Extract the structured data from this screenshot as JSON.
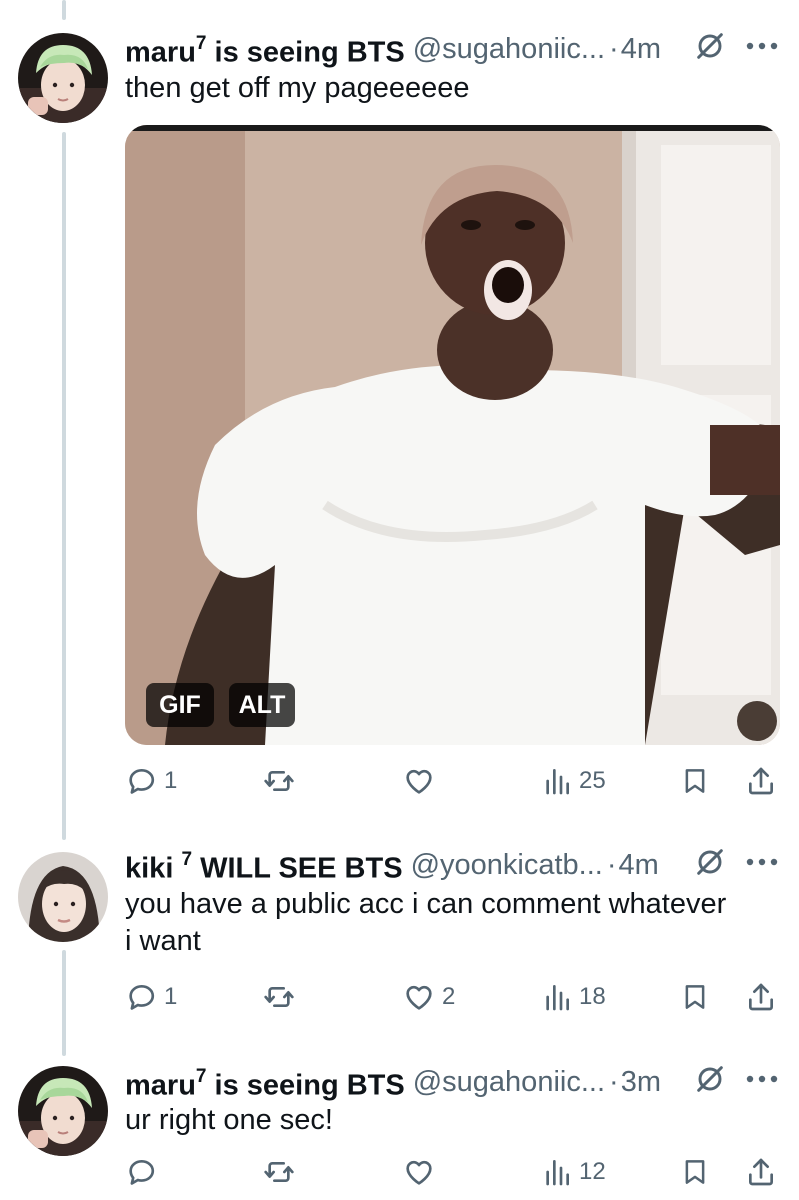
{
  "tweets": [
    {
      "name": "maru",
      "name_sup": "7",
      "name_rest": " is seeing BTS",
      "handle": "@sugahoniic...",
      "separator": "·",
      "time": "4m",
      "text": "then get off my pageeeeee",
      "media": {
        "gif_badge": "GIF",
        "alt_badge": "ALT"
      },
      "replies": "1",
      "reposts": "",
      "likes": "",
      "views": "25"
    },
    {
      "name": "kiki ",
      "name_sup": "7",
      "name_rest": " WILL SEE BTS",
      "handle": "@yoonkicatb...",
      "separator": "·",
      "time": "4m",
      "text_line1": "you have a public acc i can comment whatever",
      "text_line2": "i want",
      "replies": "1",
      "reposts": "",
      "likes": "2",
      "views": "18"
    },
    {
      "name": "maru",
      "name_sup": "7",
      "name_rest": " is seeing BTS",
      "handle": "@sugahoniic...",
      "separator": "·",
      "time": "3m",
      "text": "ur right one sec!",
      "replies": "",
      "reposts": "",
      "likes": "",
      "views": "12"
    }
  ],
  "icons": {
    "reply": "speech-bubble-icon",
    "repost": "repost-arrows-icon",
    "like": "heart-icon",
    "views": "bar-chart-icon",
    "bookmark": "bookmark-icon",
    "share": "share-upload-icon",
    "mute": "mute-circle-slash-icon",
    "more": "three-dots-icon"
  },
  "colors": {
    "text_primary": "#0f1419",
    "text_secondary": "#536471",
    "thread_line": "#cfd9de",
    "background": "#ffffff"
  }
}
